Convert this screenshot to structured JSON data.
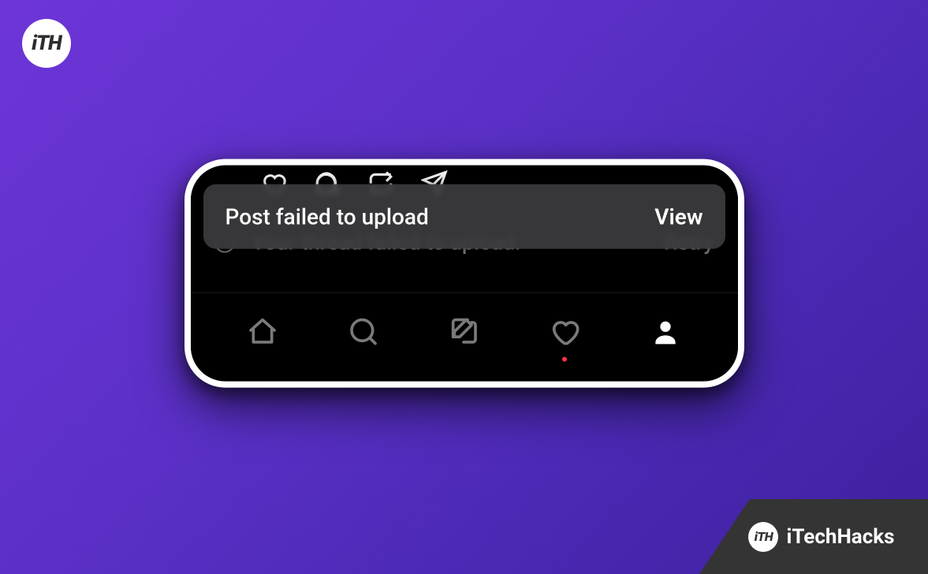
{
  "logo_text": "iTH",
  "toast": {
    "message": "Post failed to upload",
    "action": "View"
  },
  "background_row": {
    "message": "Your thread failed to upload.",
    "action": "Retry"
  },
  "nav": {
    "items": [
      {
        "name": "home",
        "active": false
      },
      {
        "name": "search",
        "active": false
      },
      {
        "name": "compose",
        "active": false
      },
      {
        "name": "activity",
        "active": false,
        "notification": true
      },
      {
        "name": "profile",
        "active": true
      }
    ]
  },
  "brand": {
    "logo": "iTH",
    "name": "iTechHacks"
  }
}
